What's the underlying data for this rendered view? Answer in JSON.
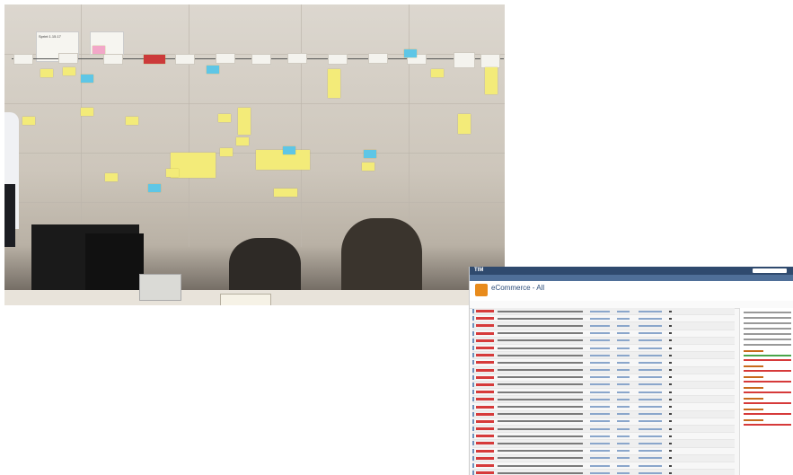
{
  "photo": {
    "sprint_card_text": "Sprint 1.15.17",
    "wall_notes": "sticky notes on timeline wall"
  },
  "screenshot": {
    "project_title": "eCommerce - All",
    "app_logo": "TIM"
  },
  "colors": {
    "wall": "#d7d1c8",
    "sticky_yellow": "#f3eb79",
    "sticky_blue": "#5ec6e6",
    "sticky_pink": "#f2a7c8",
    "topbar": "#2f4a6e",
    "status_red": "#d63a3a",
    "status_green": "#4aa54a"
  }
}
